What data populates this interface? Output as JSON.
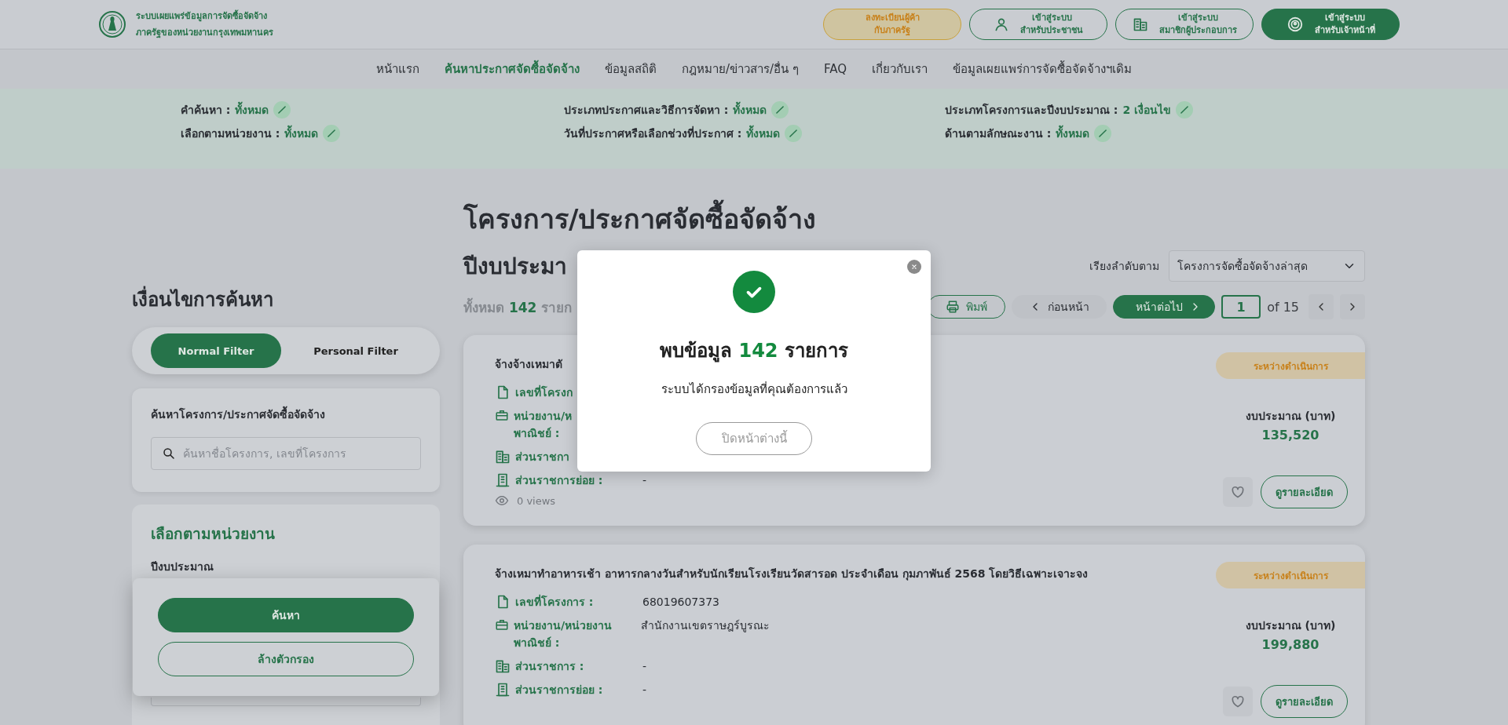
{
  "header": {
    "logo_lines": [
      "ระบบเผยแพร่ข้อมูลการจัดซื้อจัดจ้าง",
      "ภาครัฐของหน่วยงานกรุงเทพมหานคร"
    ],
    "buttons": [
      {
        "kind": "register",
        "lines": [
          "ลงทะเบียนผู้ค้า",
          "กับภาครัฐ"
        ]
      },
      {
        "kind": "citizen",
        "lines": [
          "เข้าสู่ระบบ",
          "สำหรับประชาชน"
        ]
      },
      {
        "kind": "member",
        "lines": [
          "เข้าสู่ระบบ",
          "สมาชิกผู้ประกอบการ"
        ]
      },
      {
        "kind": "staff",
        "lines": [
          "เข้าสู่ระบบ",
          "สำหรับเจ้าหน้าที่"
        ]
      }
    ]
  },
  "nav": [
    {
      "label": "หน้าแรก",
      "selected": false
    },
    {
      "label": "ค้นหาประกาศจัดซื้อจัดจ้าง",
      "selected": true
    },
    {
      "label": "ข้อมูลสถิติ",
      "selected": false
    },
    {
      "label": "กฎหมาย/ข่าวสาร/อื่น ๆ",
      "selected": false
    },
    {
      "label": "FAQ",
      "selected": false
    },
    {
      "label": "เกี่ยวกับเรา",
      "selected": false
    },
    {
      "label": "ข้อมูลเผยแพร่การจัดซื้อจัดจ้างฯเดิม",
      "selected": false
    }
  ],
  "filters": [
    {
      "label": "คำค้นหา :",
      "value": "ทั้งหมด"
    },
    {
      "label": "ประเภทประกาศและวิธีการจัดหา :",
      "value": "ทั้งหมด"
    },
    {
      "label": "ประเภทโครงการและปีงบประมาณ :",
      "value": "2 เงื่อนไข"
    },
    {
      "label": "เลือกตามหน่วยงาน :",
      "value": "ทั้งหมด"
    },
    {
      "label": "วันที่ประกาศหรือเลือกช่วงที่ประกาศ :",
      "value": "ทั้งหมด"
    },
    {
      "label": "ด้านตามลักษณะงาน :",
      "value": "ทั้งหมด"
    }
  ],
  "sidebar": {
    "title": "เงื่อนไขการค้นหา",
    "toggle": [
      {
        "label": "Normal Filter",
        "selected": true
      },
      {
        "label": "Personal Filter",
        "selected": false
      }
    ],
    "search": {
      "title": "ค้นหาโครงการ/ประกาศจัดซื้อจัดจ้าง",
      "placeholder": "ค้นหาชื่อโครงการ, เลขที่โครงการ"
    },
    "unit": {
      "title": "เลือกตามหน่วยงาน",
      "field_label": "ปีงบประมาณ"
    },
    "actions": [
      {
        "kind": "primary",
        "label": "ค้นหา"
      },
      {
        "kind": "outline",
        "label": "ล้างตัวกรอง"
      }
    ]
  },
  "page_title": "โครงการ/ประกาศจัดซื้อจัดจ้าง",
  "results": {
    "year_heading": "ปีงบประมา",
    "count_prefix": "ทั้งหมด",
    "count": "142",
    "count_suffix": "รายก",
    "sort_label": "เรียงลำดับตาม",
    "sort_value": "โครงการจัดซื้อจัดจ้างล่าสุด",
    "print": "พิมพ์",
    "prev": "ก่อนหน้า",
    "next": "หน้าต่อไป",
    "page": "1",
    "of": "of 15"
  },
  "cards": [
    {
      "title": "จ้างจ้างเหมาตั",
      "status": "ระหว่างดำเนินการ",
      "budget_label": "งบประมาณ (บาท)",
      "budget": "135,520",
      "views": "0 views",
      "details": "ดูรายละเอียด",
      "fields": [
        {
          "kind": "number",
          "label": [
            "เลขที่โครงก"
          ]
        },
        {
          "kind": "agency",
          "label": [
            "หน่วยงาน/ห",
            "พาณิชย์ :"
          ]
        },
        {
          "kind": "division",
          "label": [
            "ส่วนราชกา"
          ]
        },
        {
          "kind": "subdivision",
          "label": [
            "ส่วนราชการย่อย :"
          ],
          "value": "-"
        }
      ]
    },
    {
      "title": "จ้างเหมาทำอาหารเช้า อาหารกลางวันสำหรับนักเรียนโรงเรียนวัดสารอด ประจำเดือน กุมภาพันธ์ 2568 โดยวิธีเฉพาะเจาะจง",
      "status": "ระหว่างดำเนินการ",
      "budget_label": "งบประมาณ (บาท)",
      "budget": "199,880",
      "details": "ดูรายละเอียด",
      "fields": [
        {
          "kind": "number",
          "label": [
            "เลขที่โครงการ :"
          ],
          "value": "68019607373"
        },
        {
          "kind": "agency",
          "label": [
            "หน่วยงาน/หน่วยงาน",
            "พาณิชย์ :"
          ],
          "value": "สำนักงานเขตราษฎร์บูรณะ"
        },
        {
          "kind": "division",
          "label": [
            "ส่วนราชการ :"
          ],
          "value": "-"
        },
        {
          "kind": "subdivision",
          "label": [
            "ส่วนราชการย่อย :"
          ],
          "value": "-"
        }
      ]
    }
  ],
  "modal": {
    "heading_prefix": "พบข้อมูล",
    "count": "142",
    "heading_suffix": "รายการ",
    "message": "ระบบได้กรองข้อมูลที่คุณต้องการแล้ว",
    "close_button": "ปิดหน้าต่างนี้"
  }
}
